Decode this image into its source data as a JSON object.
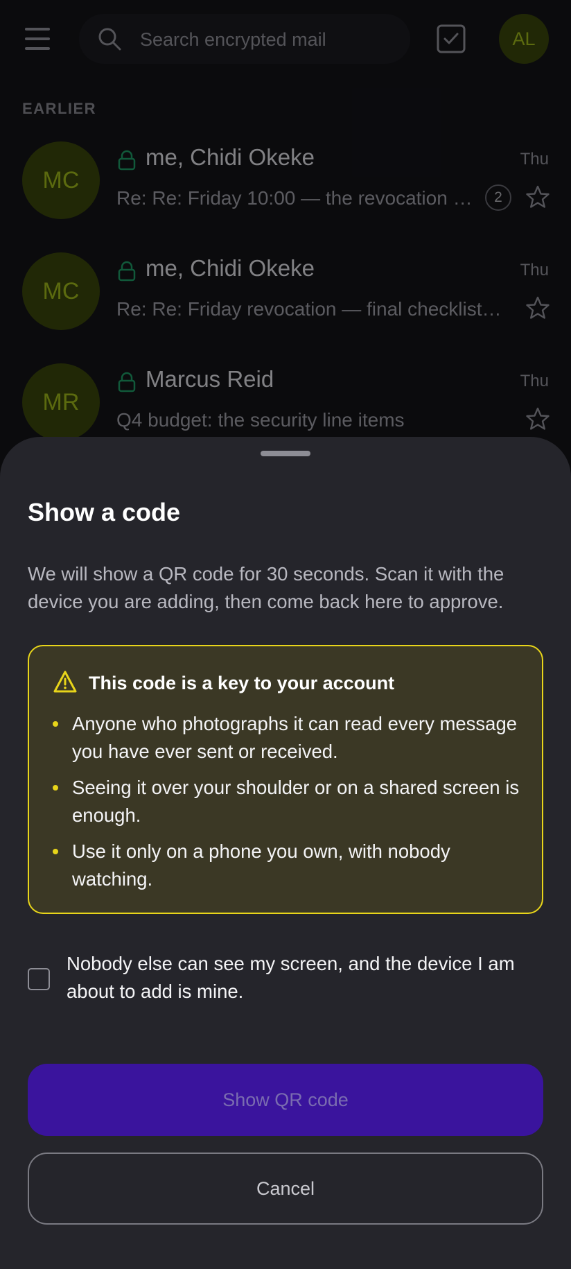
{
  "topbar": {
    "search_placeholder": "Search encrypted mail",
    "account_initials": "AL"
  },
  "inbox": {
    "section_label": "EARLIER",
    "rows": [
      {
        "initials": "MC",
        "sender": "me, Chidi Okeke",
        "subject": "Re: Re: Friday 10:00 — the revocation …",
        "time": "Thu",
        "count": "2"
      },
      {
        "initials": "MC",
        "sender": "me, Chidi Okeke",
        "subject": "Re: Re: Friday revocation — final checklist…",
        "time": "Thu"
      },
      {
        "initials": "MR",
        "sender": "Marcus Reid",
        "subject": "Q4 budget: the security line items",
        "time": "Thu"
      }
    ]
  },
  "sheet": {
    "title": "Show a code",
    "description": "We will show a QR code for 30 seconds. Scan it with the device you are adding, then come back here to approve.",
    "warning": {
      "title": "This code is a key to your account",
      "items": [
        "Anyone who photographs it can read every message you have ever sent or received.",
        "Seeing it over your shoulder or on a shared screen is enough.",
        "Use it only on a phone you own, with nobody watching."
      ]
    },
    "consent_label": "Nobody else can see my screen, and the device I am about to add is mine.",
    "primary_button": "Show QR code",
    "secondary_button": "Cancel"
  },
  "colors": {
    "accent_primary": "#3a149d",
    "warning_border": "#e8d51a",
    "warning_bg": "#3b3825",
    "avatar_bg": "#3d4a0c",
    "avatar_fg": "#a7c21c",
    "lock_green": "#1fa36a"
  }
}
